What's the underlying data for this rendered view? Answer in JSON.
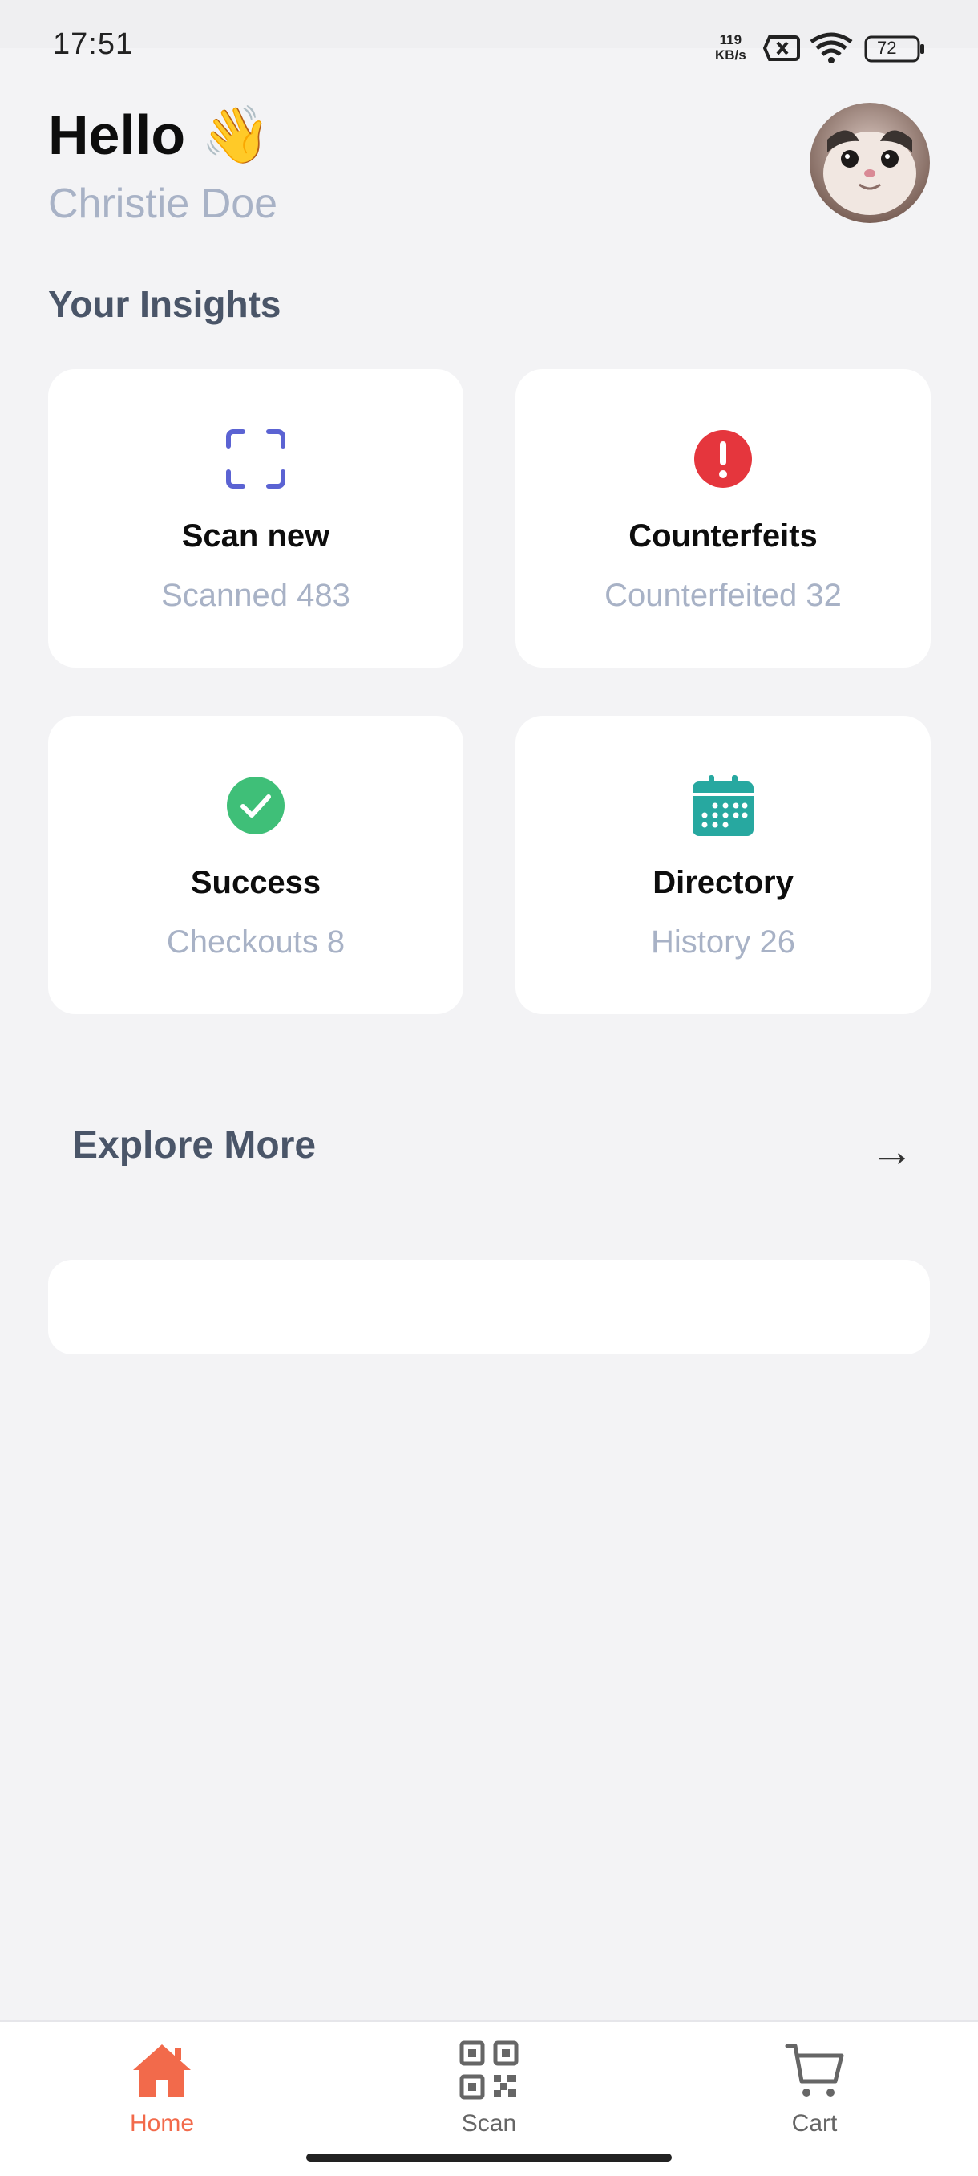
{
  "status_bar": {
    "time": "17:51",
    "speed_value": "119",
    "speed_unit": "KB/s",
    "battery": "72",
    "icons": [
      "sim-off-icon",
      "wifi-icon",
      "battery-icon"
    ]
  },
  "header": {
    "greeting": "Hello 👋",
    "username": "Christie Doe",
    "avatar_icon": "avatar-photo"
  },
  "insights": {
    "title": "Your Insights",
    "cards": [
      {
        "title": "Scan new",
        "subtitle": "Scanned 483",
        "icon": "scan-frame-icon",
        "color": "#5b63d3"
      },
      {
        "title": "Counterfeits",
        "subtitle": "Counterfeited 32",
        "icon": "alert-icon",
        "color": "#e5363d"
      },
      {
        "title": "Success",
        "subtitle": "Checkouts 8",
        "icon": "check-circle-icon",
        "color": "#3fbf78"
      },
      {
        "title": "Directory",
        "subtitle": "History 26",
        "icon": "calendar-icon",
        "color": "#27a8a0"
      }
    ]
  },
  "explore": {
    "title": "Explore More",
    "arrow": "→"
  },
  "bottom_nav": {
    "items": [
      {
        "label": "Home",
        "icon": "home-icon",
        "active": true
      },
      {
        "label": "Scan",
        "icon": "qr-code-icon",
        "active": false
      },
      {
        "label": "Cart",
        "icon": "cart-icon",
        "active": false
      }
    ],
    "active_color": "#f26a4b"
  }
}
